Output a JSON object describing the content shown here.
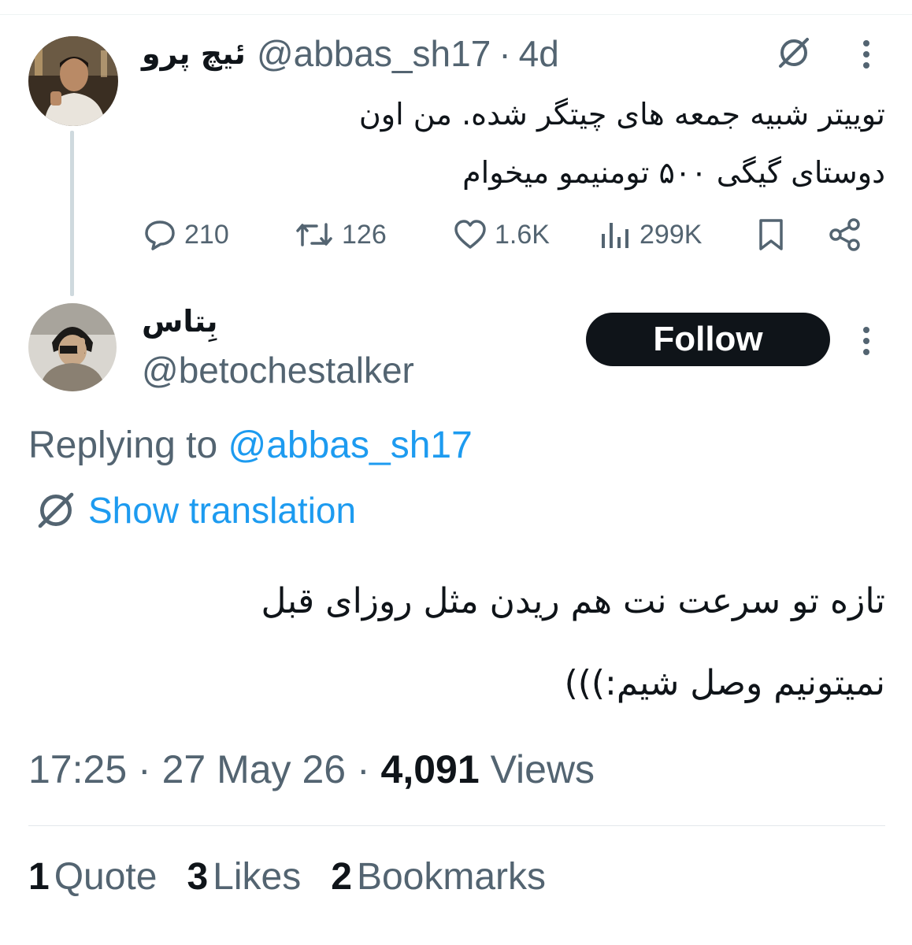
{
  "parent_tweet": {
    "display_name": "ئیچ پرو",
    "handle": "@abbas_sh17",
    "separator": "·",
    "age": "4d",
    "text_lines": [
      "توییتر شبیه جمعه های چیتگر شده. من اون",
      "دوستای گیگی ۵۰۰ تومنیمو میخوام"
    ],
    "stats": {
      "replies": "210",
      "reposts": "126",
      "likes": "1.6K",
      "views": "299K"
    },
    "icons": [
      "translate-icon",
      "more-icon",
      "reply-icon",
      "repost-icon",
      "like-icon",
      "views-icon",
      "bookmark-icon",
      "share-icon"
    ]
  },
  "reply_tweet": {
    "display_name": "بِتاس",
    "handle": "@betochestalker",
    "follow_label": "Follow",
    "replying_prefix": "Replying to",
    "replying_to": "@abbas_sh17",
    "show_translation": "Show translation",
    "text_lines": [
      "تازه تو سرعت نت هم ریدن مثل روزای قبل",
      "نمیتونیم وصل شیم:)))"
    ],
    "time": "17:25",
    "date": "27 May 26",
    "separator": "·",
    "views_count": "4,091",
    "views_label": "Views"
  },
  "engagement": [
    {
      "count": "1",
      "label": "Quote"
    },
    {
      "count": "3",
      "label": "Likes"
    },
    {
      "count": "2",
      "label": "Bookmarks"
    }
  ],
  "colors": {
    "text": "#0f1419",
    "muted": "#536471",
    "link": "#1d9bf0",
    "thread_line": "#cfd9de",
    "follow_bg": "#0f1419"
  }
}
